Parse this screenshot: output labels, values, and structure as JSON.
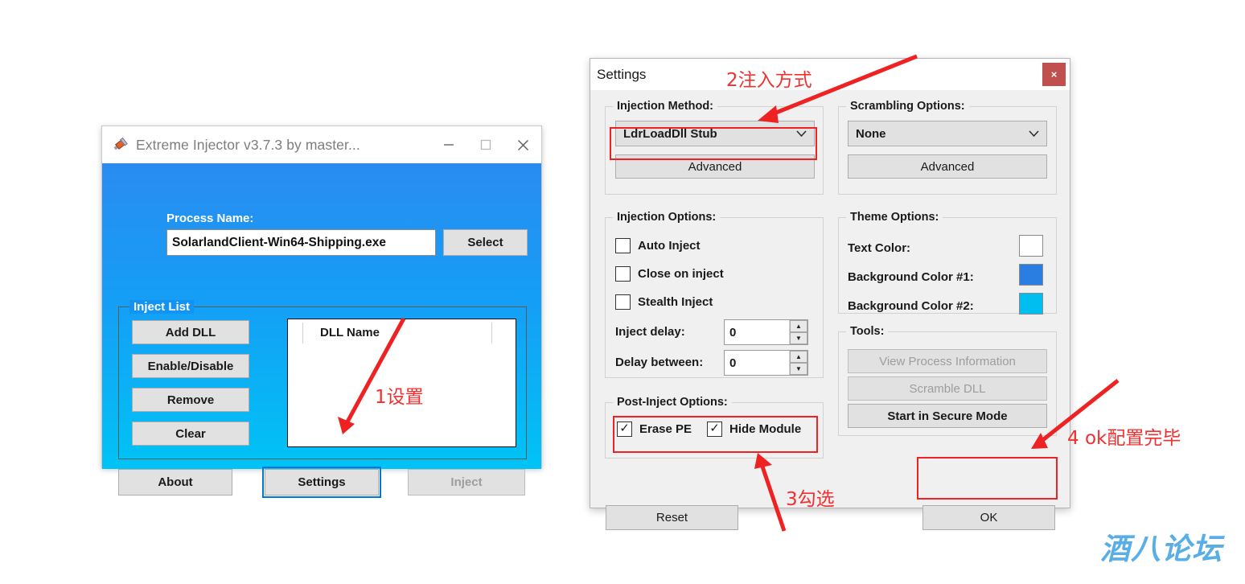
{
  "injector_window": {
    "title": "Extreme Injector v3.7.3 by master...",
    "icon": "syringe-icon",
    "titlebar_buttons": {
      "minimize": "—",
      "maximize": "□",
      "close": "✕"
    },
    "process_name_label": "Process Name:",
    "process_name_value": "SolarlandClient-Win64-Shipping.exe",
    "select_button": "Select",
    "inject_list_legend": "Inject List",
    "list_buttons": [
      "Add DLL",
      "Enable/Disable",
      "Remove",
      "Clear"
    ],
    "dll_list_header": "DLL Name",
    "dll_list_rows": [],
    "bottom_buttons": {
      "about": "About",
      "settings": "Settings",
      "inject": "Inject"
    },
    "inject_enabled": false,
    "theme": {
      "bg_top": "#2a8cf0",
      "bg_bottom": "#00c4f5"
    }
  },
  "settings_dialog": {
    "title": "Settings",
    "close_button": "×",
    "injection_method": {
      "legend": "Injection Method:",
      "selected": "LdrLoadDll Stub",
      "advanced_button": "Advanced"
    },
    "scrambling_options": {
      "legend": "Scrambling Options:",
      "selected": "None",
      "advanced_button": "Advanced"
    },
    "injection_options": {
      "legend": "Injection Options:",
      "checkboxes": [
        {
          "label": "Auto Inject",
          "checked": false
        },
        {
          "label": "Close on inject",
          "checked": false
        },
        {
          "label": "Stealth Inject",
          "checked": false
        }
      ],
      "inject_delay_label": "Inject delay:",
      "inject_delay_value": "0",
      "delay_between_label": "Delay between:",
      "delay_between_value": "0"
    },
    "theme_options": {
      "legend": "Theme Options:",
      "text_color_label": "Text Color:",
      "text_color_value": "#ffffff",
      "bg_color_1_label": "Background Color #1:",
      "bg_color_1_value": "#2a7de1",
      "bg_color_2_label": "Background Color #2:",
      "bg_color_2_value": "#00bff0"
    },
    "tools": {
      "legend": "Tools:",
      "buttons": [
        {
          "label": "View Process Information",
          "enabled": false
        },
        {
          "label": "Scramble DLL",
          "enabled": false
        },
        {
          "label": "Start in Secure Mode",
          "enabled": true
        }
      ]
    },
    "post_inject_options": {
      "legend": "Post-Inject Options:",
      "checkboxes": [
        {
          "label": "Erase PE",
          "checked": true
        },
        {
          "label": "Hide Module",
          "checked": true
        }
      ]
    },
    "reset_button": "Reset",
    "ok_button": "OK"
  },
  "annotations": [
    {
      "text": "1设置"
    },
    {
      "text": "2注入方式"
    },
    {
      "text": "3勾选"
    },
    {
      "text": "4 ok配置完毕"
    }
  ],
  "watermark": "酒八论坛",
  "accent_color": "#f23030"
}
